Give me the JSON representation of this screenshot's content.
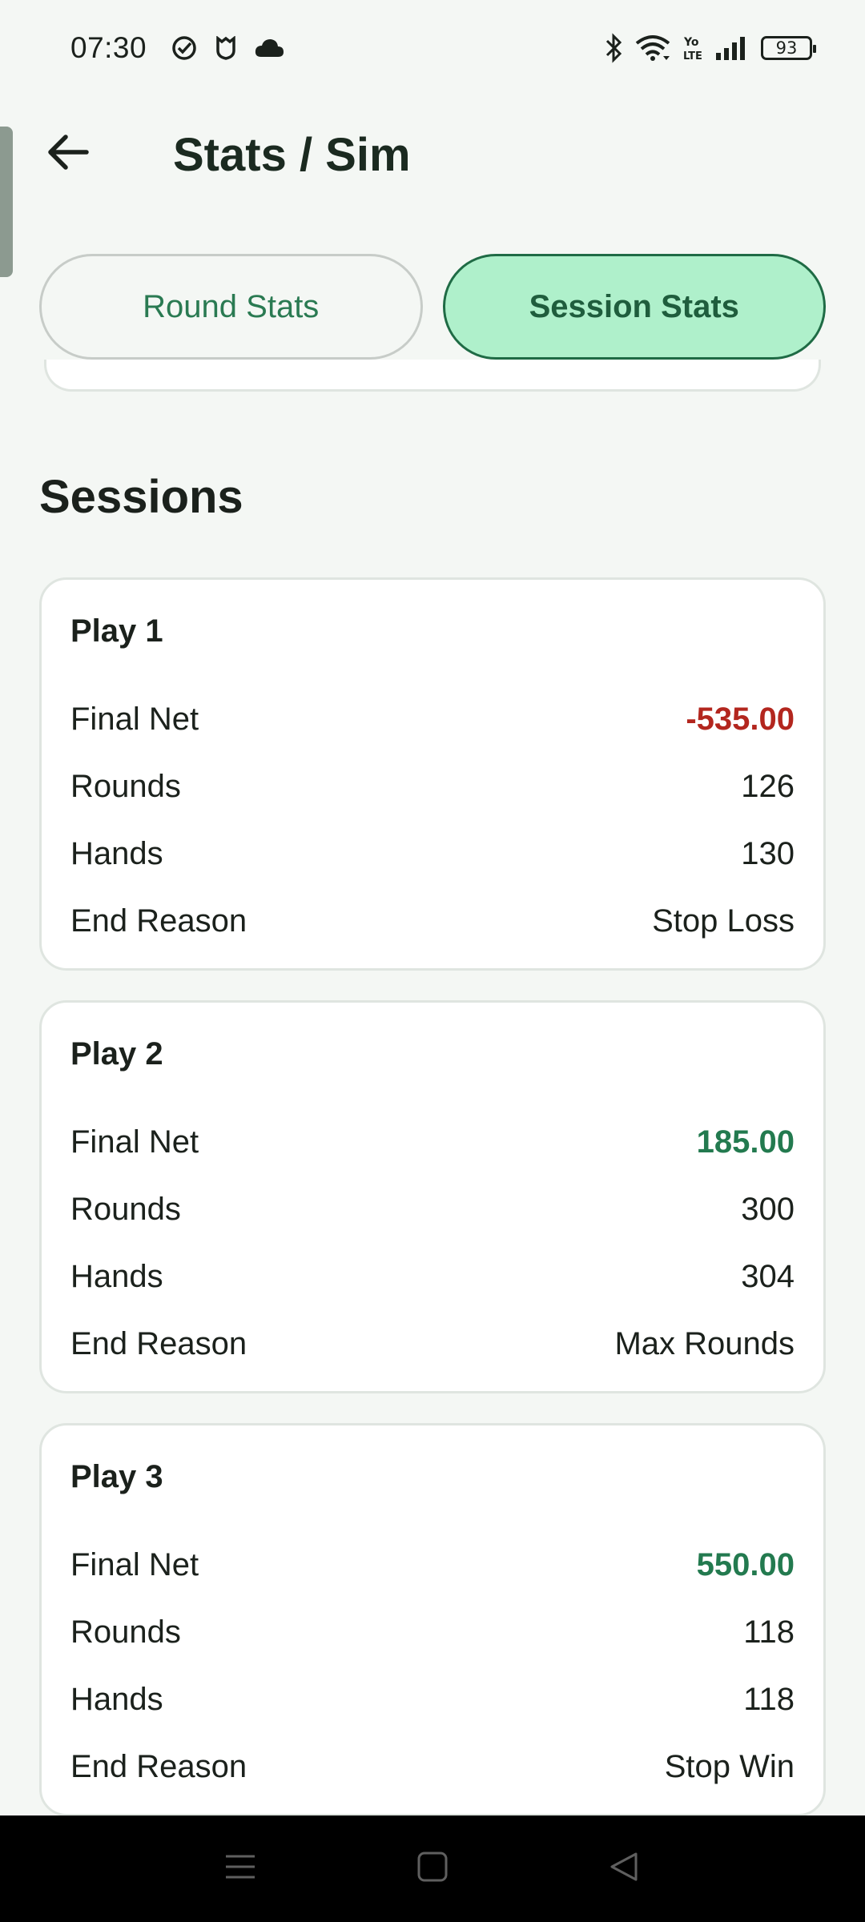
{
  "status_bar": {
    "time": "07:30",
    "battery": "93",
    "icons": [
      "check-circle-icon",
      "shield-icon",
      "cloud-icon",
      "bluetooth-icon",
      "wifi-icon",
      "volte-icon",
      "signal-icon",
      "battery-icon"
    ]
  },
  "header": {
    "title": "Stats / Sim"
  },
  "tabs": [
    {
      "label": "Round Stats",
      "active": false
    },
    {
      "label": "Session Stats",
      "active": true
    }
  ],
  "section": {
    "title": "Sessions"
  },
  "labels": {
    "final_net": "Final Net",
    "rounds": "Rounds",
    "hands": "Hands",
    "end_reason": "End Reason"
  },
  "sessions": [
    {
      "name": "Play 1",
      "final_net": "-535.00",
      "rounds": "126",
      "hands": "130",
      "end_reason": "Stop Loss"
    },
    {
      "name": "Play 2",
      "final_net": "185.00",
      "rounds": "300",
      "hands": "304",
      "end_reason": "Max Rounds"
    },
    {
      "name": "Play 3",
      "final_net": "550.00",
      "rounds": "118",
      "hands": "118",
      "end_reason": "Stop Win"
    }
  ],
  "colors": {
    "negative": "#b3261e",
    "positive": "#237a4f",
    "tab_active_bg": "#aff0cb",
    "accent": "#1f6b45"
  },
  "nav": [
    "menu-icon",
    "home-icon",
    "back-triangle-icon"
  ]
}
